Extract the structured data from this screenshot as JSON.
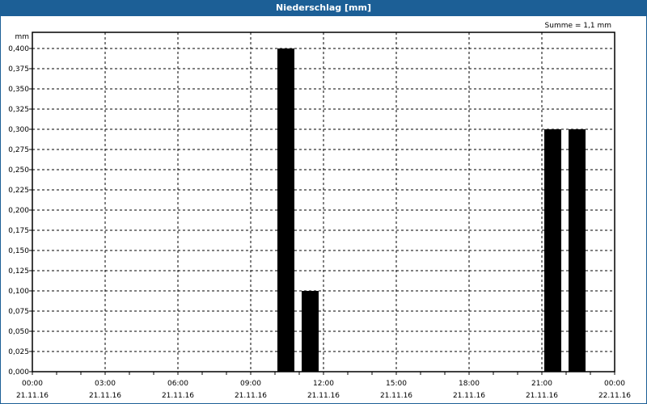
{
  "chart_data": {
    "type": "bar",
    "title": "Niederschlag [mm]",
    "ylabel": "mm",
    "annotation": "Summe = 1,1 mm",
    "ylim": [
      0,
      0.4
    ],
    "xlim_hours": [
      0,
      24
    ],
    "y_ticks": [
      "0,000",
      "0,025",
      "0,050",
      "0,075",
      "0,100",
      "0,125",
      "0,150",
      "0,175",
      "0,200",
      "0,225",
      "0,250",
      "0,275",
      "0,300",
      "0,325",
      "0,350",
      "0,375",
      "0,400"
    ],
    "x_ticks": [
      {
        "time": "00:00",
        "date": "21.11.16"
      },
      {
        "time": "03:00",
        "date": "21.11.16"
      },
      {
        "time": "06:00",
        "date": "21.11.16"
      },
      {
        "time": "09:00",
        "date": "21.11.16"
      },
      {
        "time": "12:00",
        "date": "21.11.16"
      },
      {
        "time": "15:00",
        "date": "21.11.16"
      },
      {
        "time": "18:00",
        "date": "21.11.16"
      },
      {
        "time": "21:00",
        "date": "21.11.16"
      },
      {
        "time": "00:00",
        "date": "22.11.16"
      }
    ],
    "bars": [
      {
        "hour_start": 10,
        "value": 0.4
      },
      {
        "hour_start": 11,
        "value": 0.1
      },
      {
        "hour_start": 21,
        "value": 0.3
      },
      {
        "hour_start": 22,
        "value": 0.3
      }
    ],
    "bar_color": "#000000",
    "grid": true
  }
}
